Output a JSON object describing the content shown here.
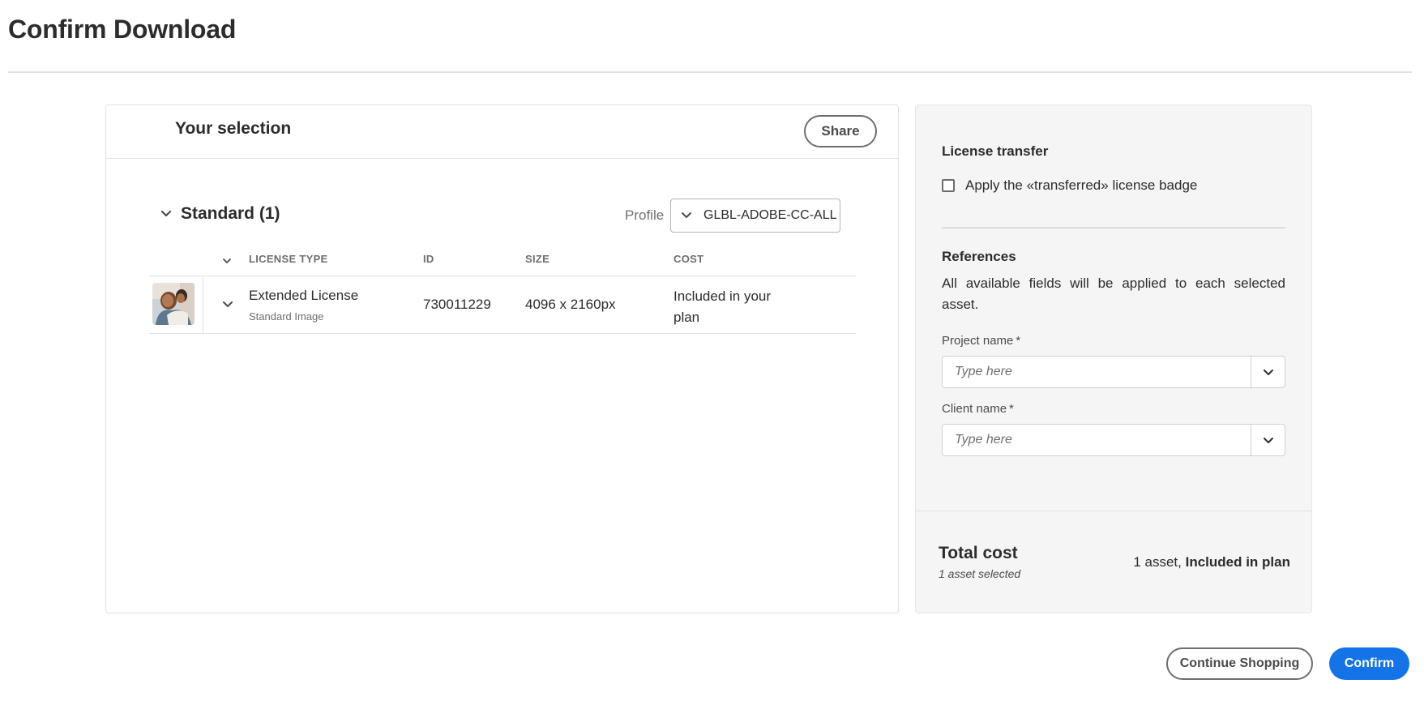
{
  "page": {
    "title": "Confirm Download"
  },
  "selection": {
    "title": "Your selection",
    "share_label": "Share",
    "group": {
      "title": "Standard (1)",
      "profile_label": "Profile",
      "profile_value": "GLBL-ADOBE-CC-ALL"
    },
    "columns": [
      "LICENSE TYPE",
      "ID",
      "SIZE",
      "COST"
    ],
    "rows": [
      {
        "license_type": "Extended License",
        "license_subtype": "Standard Image",
        "id": "730011229",
        "size": "4096 x 2160px",
        "cost": "Included in your plan"
      }
    ]
  },
  "side_panel": {
    "license_transfer": {
      "heading": "License transfer",
      "checkbox_label": "Apply the «transferred» license badge",
      "checked": false
    },
    "references": {
      "heading": "References",
      "description": "All available fields will be applied to each selected asset.",
      "fields": [
        {
          "label": "Project name",
          "required_mark": "*",
          "placeholder": "Type here"
        },
        {
          "label": "Client name",
          "required_mark": "*",
          "placeholder": "Type here"
        }
      ]
    },
    "total": {
      "title": "Total cost",
      "subtitle": "1 asset selected",
      "summary_prefix": "1 asset,",
      "summary_value": "Included in plan"
    }
  },
  "actions": {
    "continue_label": "Continue Shopping",
    "confirm_label": "Confirm"
  },
  "colors": {
    "accent": "#1473e6",
    "text": "#2c2c2c",
    "muted": "#6e6e6e",
    "panel_bg": "#f5f5f5",
    "border": "#e1e1e1"
  },
  "icons": [
    "chevron-down-icon",
    "image-thumbnail"
  ]
}
